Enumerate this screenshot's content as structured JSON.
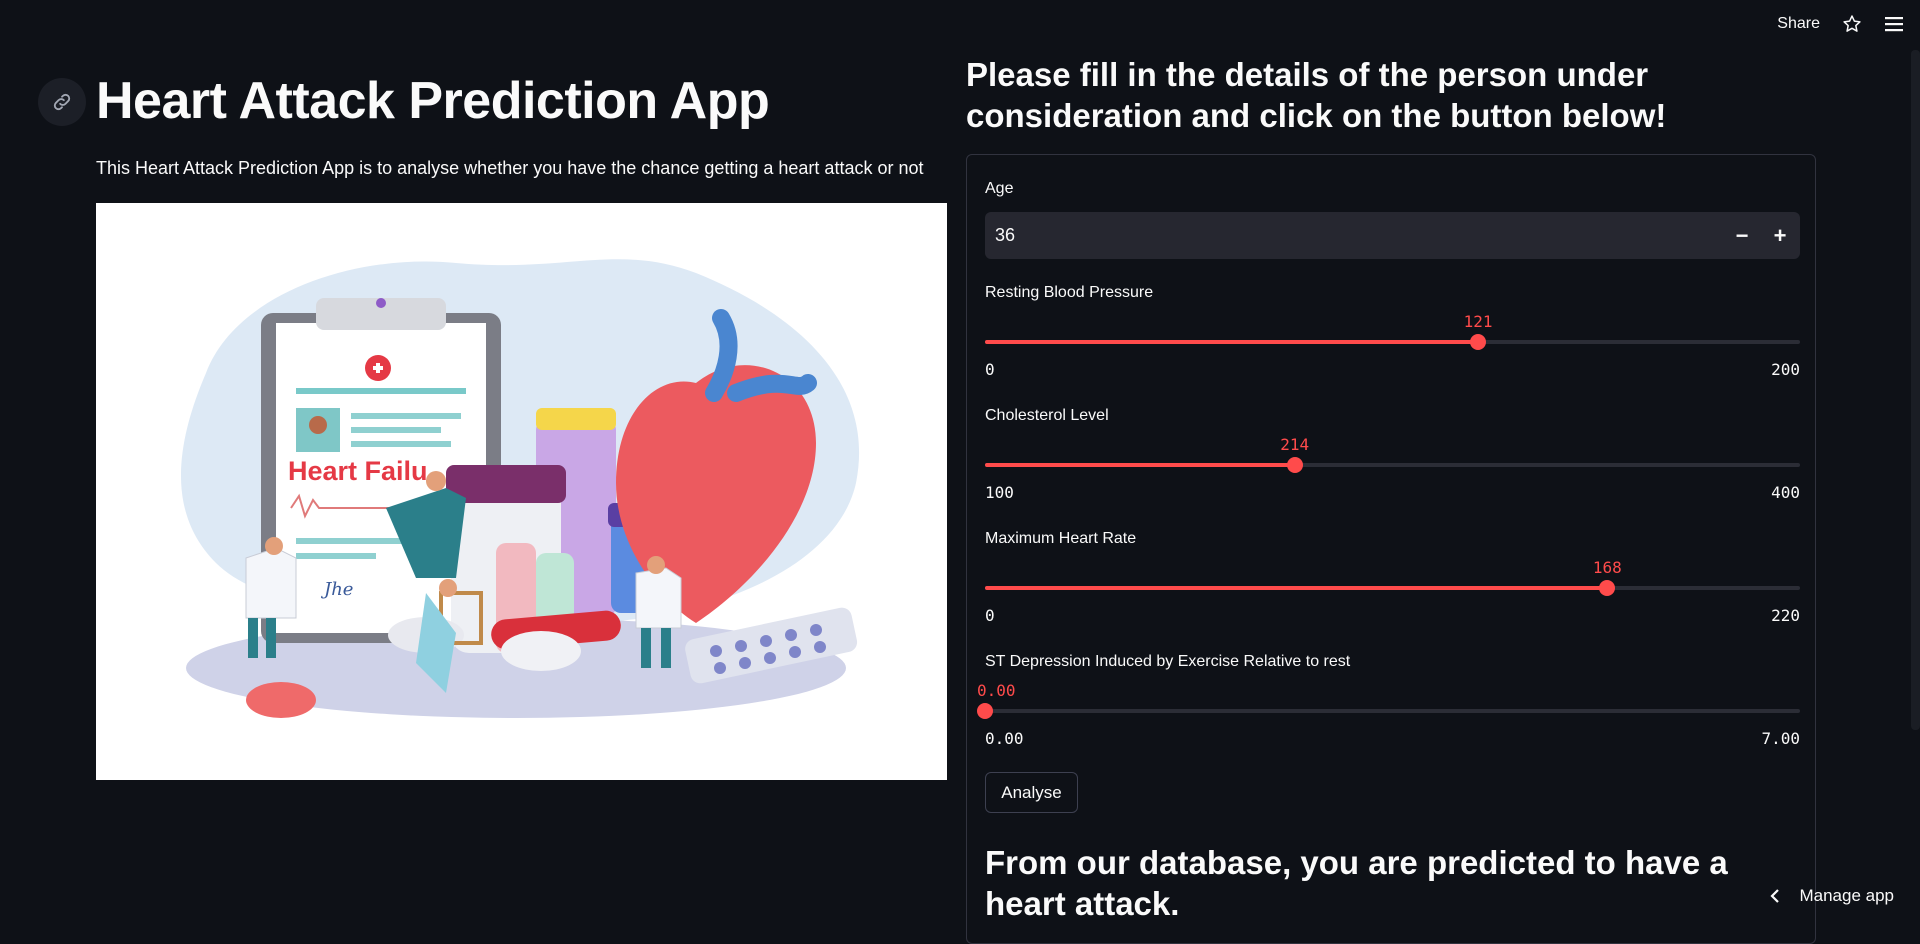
{
  "toolbar": {
    "share_label": "Share",
    "star_icon": "star-icon",
    "menu_icon": "hamburger-menu-icon"
  },
  "left": {
    "title": "Heart Attack Prediction App",
    "intro": "This Heart Attack Prediction App is to analyse whether you have the chance getting a heart attack or not",
    "hero_caption": "Heart Failu",
    "signature": "Jhe"
  },
  "form": {
    "heading": "Please fill in the details of the person under consideration and click on the button below!",
    "age": {
      "label": "Age",
      "value": "36",
      "minus": "−",
      "plus": "+"
    },
    "sliders": [
      {
        "label": "Resting Blood Pressure",
        "value": 121,
        "display": "121",
        "min": 0,
        "max": 200,
        "min_label": "0",
        "max_label": "200"
      },
      {
        "label": "Cholesterol Level",
        "value": 214,
        "display": "214",
        "min": 100,
        "max": 400,
        "min_label": "100",
        "max_label": "400"
      },
      {
        "label": "Maximum Heart Rate",
        "value": 168,
        "display": "168",
        "min": 0,
        "max": 220,
        "min_label": "0",
        "max_label": "220"
      },
      {
        "label": "ST Depression Induced by Exercise Relative to rest",
        "value": 0.0,
        "display": "0.00",
        "min": 0,
        "max": 7,
        "min_label": "0.00",
        "max_label": "7.00"
      }
    ],
    "button_label": "Analyse",
    "result": "From our database, you are predicted to have a heart attack."
  },
  "footer": {
    "manage_app": "Manage app"
  },
  "colors": {
    "background": "#0e1117",
    "accent": "#ff4b4b",
    "input_bg": "#262730",
    "text": "#fafafa"
  }
}
